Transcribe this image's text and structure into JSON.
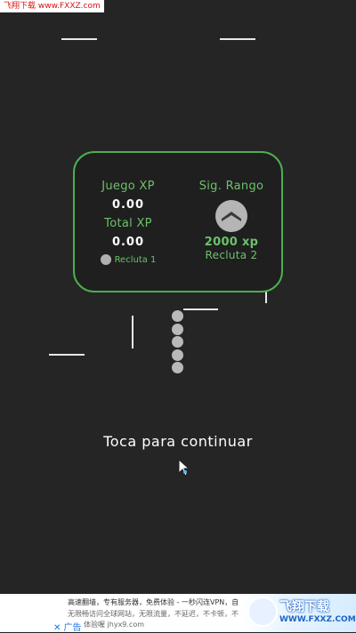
{
  "watermark": {
    "text": "飞翔下载 www.FXXZ.com"
  },
  "panel": {
    "game_xp_label": "Juego XP",
    "game_xp_value": "0.00",
    "total_xp_label": "Total XP",
    "total_xp_value": "0.00",
    "current_rank": "Recluta 1",
    "next_rank_label": "Sig. Rango",
    "next_rank_xp": "2000 xp",
    "next_rank_name": "Recluta 2"
  },
  "prompt": {
    "tap_text": "Toca para continuar"
  },
  "snake": {
    "segments": 5
  },
  "colors": {
    "background": "#252525",
    "accent_green": "#4caf50",
    "label_green": "#6bc16b"
  },
  "icons": {
    "rank": "chevron-up-icon",
    "cursor": "mouse-cursor-icon"
  },
  "ad": {
    "line1": "高速翻墙，专有服务器，免费体验 - 一秒闪连VPN，自",
    "line2": "无限畅访问全球网站，无限流量，不延迟，不卡顿，不",
    "line3": "体验喔 jhyx9.com",
    "close_label": "✕ 广告",
    "logo_main": "飞翔下载",
    "logo_sub": "WWW.FXXZ.COM"
  }
}
